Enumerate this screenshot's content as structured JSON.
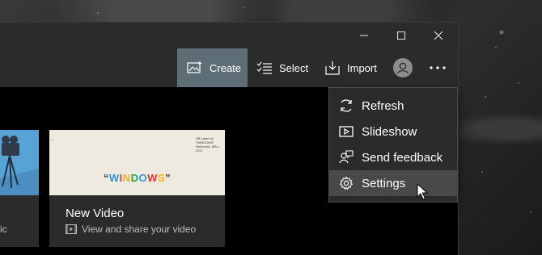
{
  "window": {
    "minimize_icon": "minimize-icon",
    "maximize_icon": "maximize-icon",
    "close_icon": "close-icon"
  },
  "toolbar": {
    "create_label": "Create",
    "select_label": "Select",
    "import_label": "Import",
    "accent_color": "#5e6e76"
  },
  "cards": [
    {
      "title": "",
      "subtitle": "ic"
    },
    {
      "title": "New Video",
      "subtitle": "View and share your video",
      "thumbnail_word": "“WINDOWS”",
      "thumbnail_note": "Off-Label do “WINDOWS” Redmond, WA c. 2017"
    }
  ],
  "menu": {
    "items": [
      {
        "label": "Refresh",
        "icon": "refresh-icon"
      },
      {
        "label": "Slideshow",
        "icon": "slideshow-icon"
      },
      {
        "label": "Send feedback",
        "icon": "feedback-icon"
      },
      {
        "label": "Settings",
        "icon": "gear-icon",
        "highlighted": true
      }
    ]
  }
}
